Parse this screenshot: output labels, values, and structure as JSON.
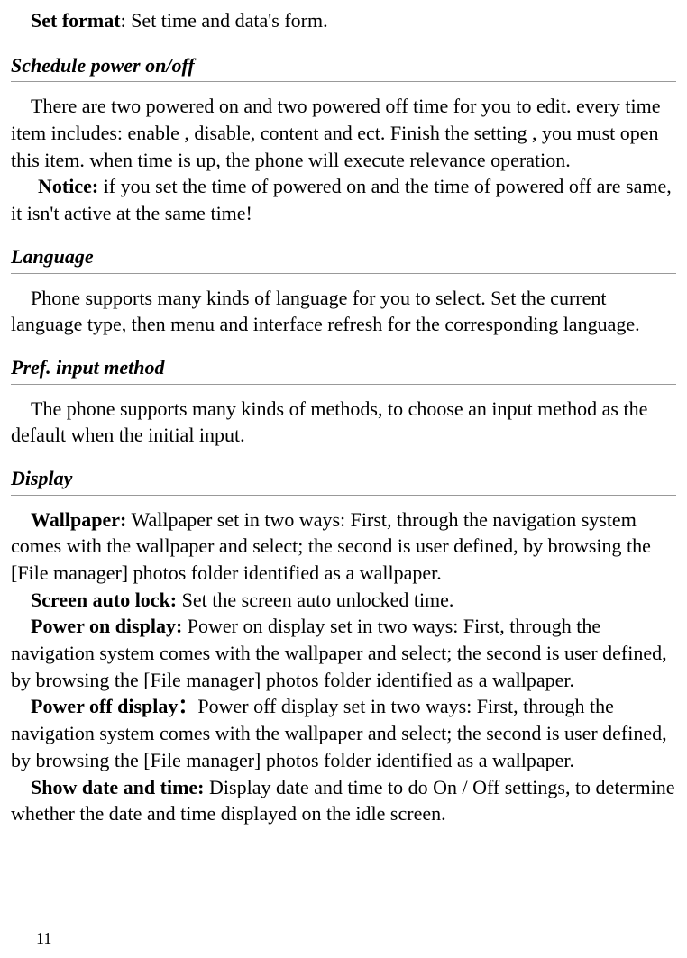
{
  "setFormat": {
    "label": "Set format",
    "text": ": Set time and data's form."
  },
  "sections": {
    "schedule": {
      "heading": "Schedule power on/off",
      "body": "There are two powered on and two powered off time for you to edit. every time item includes: enable , disable, content and ect. Finish the setting , you must open this item. when time is up, the phone will execute relevance operation.",
      "noticeLabel": "Notice:",
      "noticeText": " if you set the time of powered on and the time of powered off are same, it isn't active at the same time!"
    },
    "language": {
      "heading": "Language",
      "body": "Phone supports many kinds of language for you to select. Set the current language type, then menu and interface refresh for the corresponding language."
    },
    "prefInput": {
      "heading": "Pref. input method",
      "body": "The phone supports many kinds of methods, to choose an input method as the default when the initial input."
    },
    "display": {
      "heading": "Display",
      "items": {
        "wallpaper": {
          "label": "Wallpaper:",
          "text": "   Wallpaper set in two ways: First, through the navigation system comes with the wallpaper and select; the second is user defined, by browsing the [File manager] photos folder identified as a wallpaper."
        },
        "screenAutoLock": {
          "label": "Screen auto lock:",
          "text": "   Set the screen auto unlocked time."
        },
        "powerOn": {
          "label": "Power on display:",
          "text": "   Power on display set in two ways: First, through the navigation system comes with the wallpaper and select; the second is user defined, by browsing the [File manager] photos folder identified as a wallpaper."
        },
        "powerOff": {
          "label": "Power off display：",
          "text": "Power off display set in two ways: First, through the navigation system comes with the wallpaper and select; the second is user defined, by browsing the [File manager] photos folder identified as a wallpaper."
        },
        "showDateTime": {
          "label": "Show date and time:",
          "text": "   Display date and time to do On / Off settings, to determine whether the date and time displayed on the idle screen."
        }
      }
    }
  },
  "pageNumber": "11"
}
